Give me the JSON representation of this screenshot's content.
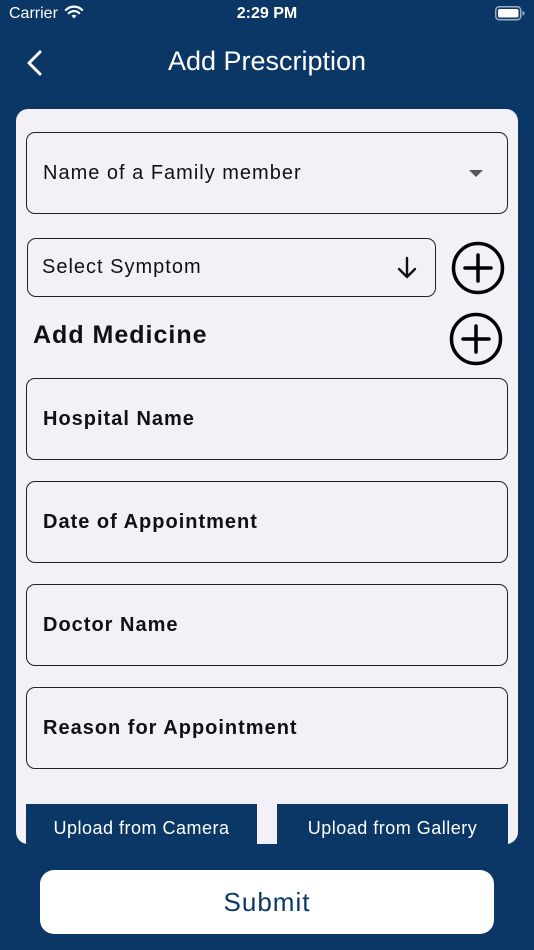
{
  "status_bar": {
    "carrier": "Carrier",
    "time": "2:29 PM"
  },
  "nav": {
    "title": "Add Prescription"
  },
  "form": {
    "family_member_placeholder": "Name of a Family member",
    "symptom_placeholder": "Select Symptom",
    "add_medicine_label": "Add Medicine",
    "hospital_name_placeholder": "Hospital Name",
    "date_placeholder": "Date of Appointment",
    "doctor_name_placeholder": "Doctor Name",
    "reason_placeholder": "Reason for Appointment"
  },
  "upload": {
    "camera_label": "Upload from Camera",
    "gallery_label": "Upload from Gallery"
  },
  "submit_label": "Submit",
  "colors": {
    "primary": "#0b3766",
    "card_background": "#f3f0f7",
    "text": "#111111"
  },
  "icons": {
    "back": "chevron-left-icon",
    "wifi": "wifi-icon",
    "battery": "battery-icon",
    "symptom_dropdown": "arrow-down-icon",
    "family_dropdown": "caret-down-icon",
    "add_symptom": "plus-circle-icon",
    "add_medicine": "plus-circle-icon"
  }
}
